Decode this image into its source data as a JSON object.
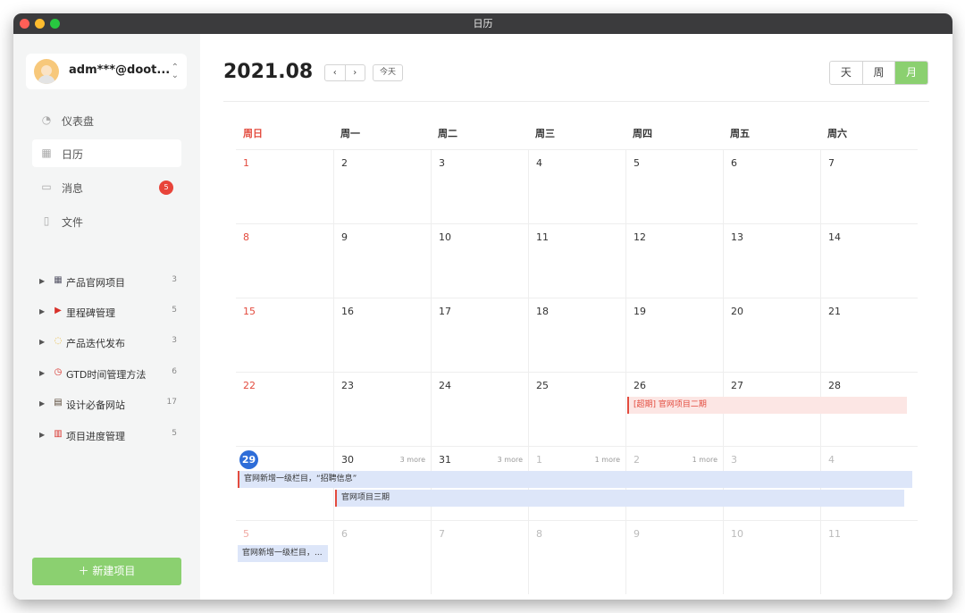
{
  "window": {
    "title": "日历"
  },
  "account": {
    "name": "adm***@doot...",
    "chevron": "⌃⌄"
  },
  "nav": [
    {
      "label": "仪表盘",
      "icon": "dashboard-icon",
      "glyph": "◔"
    },
    {
      "label": "日历",
      "icon": "calendar-icon",
      "glyph": "▦"
    },
    {
      "label": "消息",
      "icon": "message-icon",
      "glyph": "▭",
      "badge": "5"
    },
    {
      "label": "文件",
      "icon": "file-icon",
      "glyph": "▯"
    }
  ],
  "projects": [
    {
      "emoji": "▦",
      "label": "产品官网项目",
      "count": "3"
    },
    {
      "emoji": "▶",
      "label": "里程碑管理",
      "count": "5"
    },
    {
      "emoji": "◌",
      "label": "产品迭代发布",
      "count": "3"
    },
    {
      "emoji": "◷",
      "label": "GTD时间管理方法",
      "count": "6"
    },
    {
      "emoji": "▤",
      "label": "设计必备网站",
      "count": "17"
    },
    {
      "emoji": "▥",
      "label": "项目进度管理",
      "count": "5"
    }
  ],
  "new_project_button": "＋  新建项目",
  "header": {
    "month": "2021.08",
    "prev": "‹",
    "next": "›",
    "today": "今天"
  },
  "views": [
    "天",
    "周",
    "月"
  ],
  "weekdays": [
    "周日",
    "周一",
    "周二",
    "周三",
    "周四",
    "周五",
    "周六"
  ],
  "weeks": [
    [
      "1",
      "2",
      "3",
      "4",
      "5",
      "6",
      "7"
    ],
    [
      "8",
      "9",
      "10",
      "11",
      "12",
      "13",
      "14"
    ],
    [
      "15",
      "16",
      "17",
      "18",
      "19",
      "20",
      "21"
    ],
    [
      "22",
      "23",
      "24",
      "25",
      "26",
      "27",
      "28"
    ],
    [
      "29",
      "30",
      "31",
      "1",
      "2",
      "3",
      "4"
    ],
    [
      "5",
      "6",
      "7",
      "8",
      "9",
      "10",
      "11"
    ]
  ],
  "more_labels": {
    "w4d1": "3 more",
    "w4d2": "3 more",
    "w4d3": "1 more",
    "w4d4": "1 more"
  },
  "events": {
    "overdue": "[超期] 官网项目二期",
    "recruit": "官网新增一级栏目，“招聘信息”",
    "phase3": "官网项目三期",
    "recruit_short": "官网新增一级栏目，..."
  },
  "colors": {
    "accent_green": "#8bd070",
    "today_blue": "#2e6dd8",
    "sunday_red": "#e34b3e"
  }
}
